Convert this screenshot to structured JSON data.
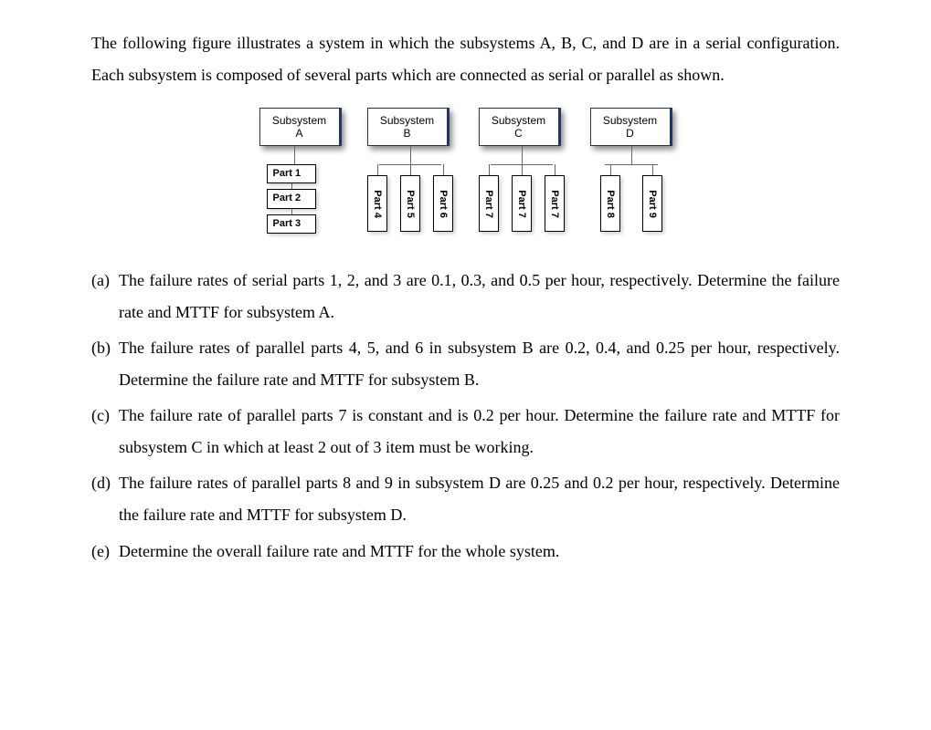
{
  "intro": "The following figure illustrates a system in which the subsystems A, B, C, and D are in a serial configuration. Each subsystem is composed of several parts which are connected as serial or parallel as shown.",
  "subsystems": {
    "A": {
      "title": "Subsystem\nA",
      "parts": [
        "Part 1",
        "Part 2",
        "Part 3"
      ],
      "layout": "serial"
    },
    "B": {
      "title": "Subsystem\nB",
      "parts": [
        "Part 4",
        "Part 5",
        "Part 6"
      ],
      "layout": "parallel"
    },
    "C": {
      "title": "Subsystem\nC",
      "parts": [
        "Part 7",
        "Part 7",
        "Part 7"
      ],
      "layout": "parallel"
    },
    "D": {
      "title": "Subsystem\nD",
      "parts": [
        "Part 8",
        "Part 9"
      ],
      "layout": "parallel"
    }
  },
  "questions": [
    {
      "label": "(a)",
      "text": "The failure rates of serial parts 1, 2, and 3 are 0.1, 0.3, and 0.5 per hour, respectively. Determine the failure rate and MTTF for subsystem A."
    },
    {
      "label": "(b)",
      "text": "The failure rates of parallel parts 4, 5, and 6 in subsystem B are 0.2, 0.4, and 0.25 per hour, respectively. Determine the failure rate and MTTF for subsystem B."
    },
    {
      "label": "(c)",
      "text": "The failure rate of parallel parts 7 is constant and is 0.2 per hour. Determine the failure rate and MTTF for subsystem C in which at least 2 out of 3 item must be working."
    },
    {
      "label": "(d)",
      "text": "The failure rates of parallel parts 8 and 9 in subsystem D are 0.25 and 0.2 per hour, respectively. Determine the failure rate and MTTF for subsystem D."
    },
    {
      "label": "(e)",
      "text": "Determine the overall failure rate and MTTF for the whole system."
    }
  ]
}
